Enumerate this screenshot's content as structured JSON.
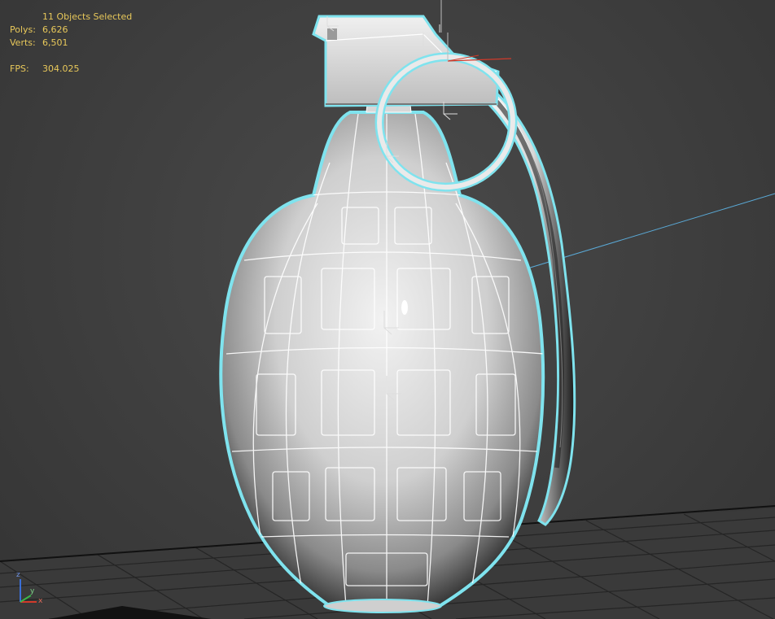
{
  "viewport": {
    "stats": {
      "selection": "11 Objects Selected",
      "polys_label": "Polys:",
      "polys_value": "6,626",
      "verts_label": "Verts:",
      "verts_value": "6,501",
      "fps_label": "FPS:",
      "fps_value": "304.025"
    },
    "gizmo_labels": {
      "x": "x",
      "y": "y",
      "z": "z"
    },
    "colors": {
      "background": "#404040",
      "stats_text": "#e8c85a",
      "selection_outline": "#7fe3ee",
      "grid": "#222222",
      "axis_x": "#d23a2a",
      "axis_y": "#3bb54a",
      "axis_z": "#3a6fd8"
    },
    "object": "grenade-model"
  }
}
